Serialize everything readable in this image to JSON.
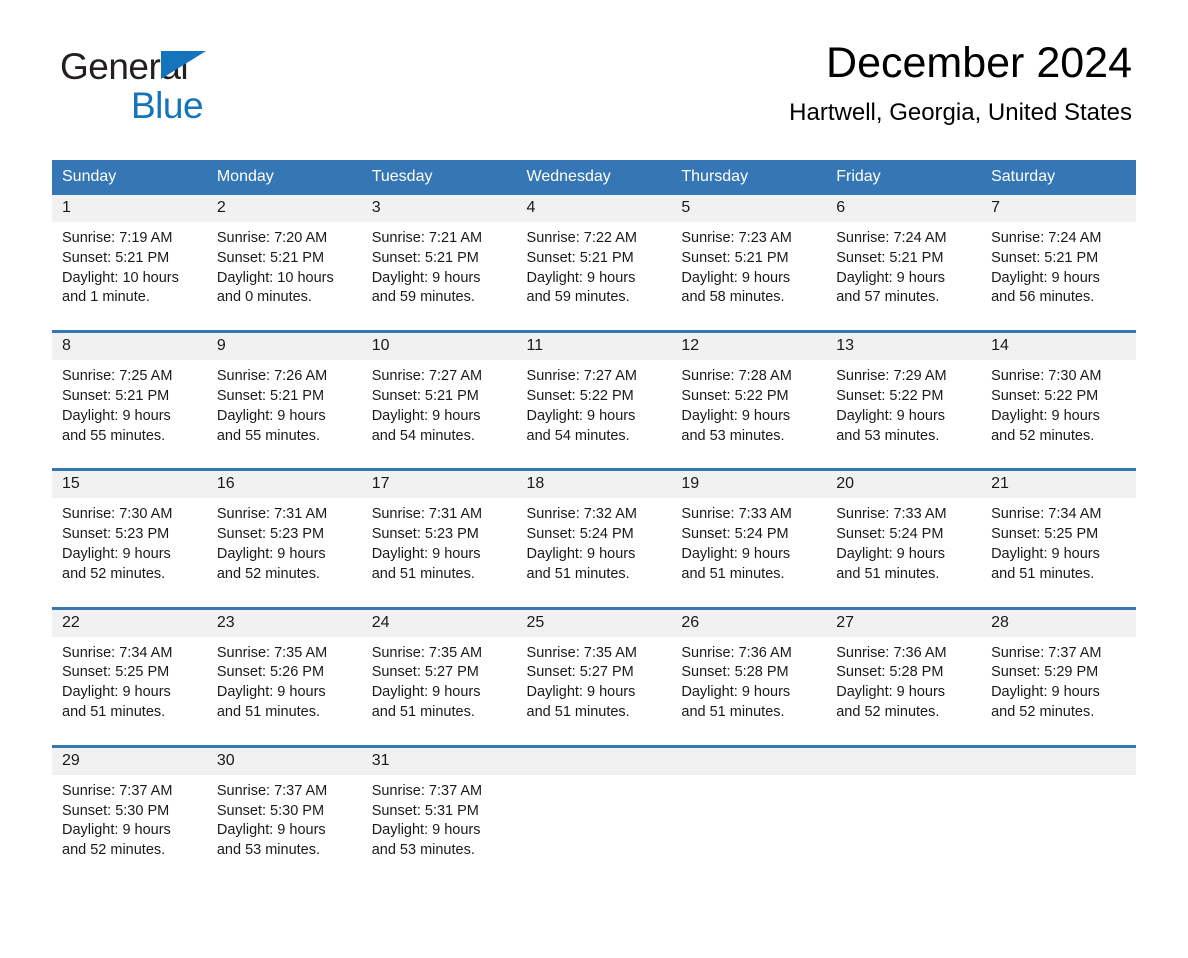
{
  "brand": {
    "name_line1": "General",
    "name_line2": "Blue",
    "accent_color": "#1474bc"
  },
  "header": {
    "title": "December 2024",
    "location": "Hartwell, Georgia, United States"
  },
  "calendar": {
    "header_bg": "#3576b5",
    "daynum_bg": "#f1f1f1",
    "weekday_headers": [
      "Sunday",
      "Monday",
      "Tuesday",
      "Wednesday",
      "Thursday",
      "Friday",
      "Saturday"
    ],
    "weeks": [
      [
        {
          "day": "1",
          "sunrise": "Sunrise: 7:19 AM",
          "sunset": "Sunset: 5:21 PM",
          "daylight_1": "Daylight: 10 hours",
          "daylight_2": "and 1 minute."
        },
        {
          "day": "2",
          "sunrise": "Sunrise: 7:20 AM",
          "sunset": "Sunset: 5:21 PM",
          "daylight_1": "Daylight: 10 hours",
          "daylight_2": "and 0 minutes."
        },
        {
          "day": "3",
          "sunrise": "Sunrise: 7:21 AM",
          "sunset": "Sunset: 5:21 PM",
          "daylight_1": "Daylight: 9 hours",
          "daylight_2": "and 59 minutes."
        },
        {
          "day": "4",
          "sunrise": "Sunrise: 7:22 AM",
          "sunset": "Sunset: 5:21 PM",
          "daylight_1": "Daylight: 9 hours",
          "daylight_2": "and 59 minutes."
        },
        {
          "day": "5",
          "sunrise": "Sunrise: 7:23 AM",
          "sunset": "Sunset: 5:21 PM",
          "daylight_1": "Daylight: 9 hours",
          "daylight_2": "and 58 minutes."
        },
        {
          "day": "6",
          "sunrise": "Sunrise: 7:24 AM",
          "sunset": "Sunset: 5:21 PM",
          "daylight_1": "Daylight: 9 hours",
          "daylight_2": "and 57 minutes."
        },
        {
          "day": "7",
          "sunrise": "Sunrise: 7:24 AM",
          "sunset": "Sunset: 5:21 PM",
          "daylight_1": "Daylight: 9 hours",
          "daylight_2": "and 56 minutes."
        }
      ],
      [
        {
          "day": "8",
          "sunrise": "Sunrise: 7:25 AM",
          "sunset": "Sunset: 5:21 PM",
          "daylight_1": "Daylight: 9 hours",
          "daylight_2": "and 55 minutes."
        },
        {
          "day": "9",
          "sunrise": "Sunrise: 7:26 AM",
          "sunset": "Sunset: 5:21 PM",
          "daylight_1": "Daylight: 9 hours",
          "daylight_2": "and 55 minutes."
        },
        {
          "day": "10",
          "sunrise": "Sunrise: 7:27 AM",
          "sunset": "Sunset: 5:21 PM",
          "daylight_1": "Daylight: 9 hours",
          "daylight_2": "and 54 minutes."
        },
        {
          "day": "11",
          "sunrise": "Sunrise: 7:27 AM",
          "sunset": "Sunset: 5:22 PM",
          "daylight_1": "Daylight: 9 hours",
          "daylight_2": "and 54 minutes."
        },
        {
          "day": "12",
          "sunrise": "Sunrise: 7:28 AM",
          "sunset": "Sunset: 5:22 PM",
          "daylight_1": "Daylight: 9 hours",
          "daylight_2": "and 53 minutes."
        },
        {
          "day": "13",
          "sunrise": "Sunrise: 7:29 AM",
          "sunset": "Sunset: 5:22 PM",
          "daylight_1": "Daylight: 9 hours",
          "daylight_2": "and 53 minutes."
        },
        {
          "day": "14",
          "sunrise": "Sunrise: 7:30 AM",
          "sunset": "Sunset: 5:22 PM",
          "daylight_1": "Daylight: 9 hours",
          "daylight_2": "and 52 minutes."
        }
      ],
      [
        {
          "day": "15",
          "sunrise": "Sunrise: 7:30 AM",
          "sunset": "Sunset: 5:23 PM",
          "daylight_1": "Daylight: 9 hours",
          "daylight_2": "and 52 minutes."
        },
        {
          "day": "16",
          "sunrise": "Sunrise: 7:31 AM",
          "sunset": "Sunset: 5:23 PM",
          "daylight_1": "Daylight: 9 hours",
          "daylight_2": "and 52 minutes."
        },
        {
          "day": "17",
          "sunrise": "Sunrise: 7:31 AM",
          "sunset": "Sunset: 5:23 PM",
          "daylight_1": "Daylight: 9 hours",
          "daylight_2": "and 51 minutes."
        },
        {
          "day": "18",
          "sunrise": "Sunrise: 7:32 AM",
          "sunset": "Sunset: 5:24 PM",
          "daylight_1": "Daylight: 9 hours",
          "daylight_2": "and 51 minutes."
        },
        {
          "day": "19",
          "sunrise": "Sunrise: 7:33 AM",
          "sunset": "Sunset: 5:24 PM",
          "daylight_1": "Daylight: 9 hours",
          "daylight_2": "and 51 minutes."
        },
        {
          "day": "20",
          "sunrise": "Sunrise: 7:33 AM",
          "sunset": "Sunset: 5:24 PM",
          "daylight_1": "Daylight: 9 hours",
          "daylight_2": "and 51 minutes."
        },
        {
          "day": "21",
          "sunrise": "Sunrise: 7:34 AM",
          "sunset": "Sunset: 5:25 PM",
          "daylight_1": "Daylight: 9 hours",
          "daylight_2": "and 51 minutes."
        }
      ],
      [
        {
          "day": "22",
          "sunrise": "Sunrise: 7:34 AM",
          "sunset": "Sunset: 5:25 PM",
          "daylight_1": "Daylight: 9 hours",
          "daylight_2": "and 51 minutes."
        },
        {
          "day": "23",
          "sunrise": "Sunrise: 7:35 AM",
          "sunset": "Sunset: 5:26 PM",
          "daylight_1": "Daylight: 9 hours",
          "daylight_2": "and 51 minutes."
        },
        {
          "day": "24",
          "sunrise": "Sunrise: 7:35 AM",
          "sunset": "Sunset: 5:27 PM",
          "daylight_1": "Daylight: 9 hours",
          "daylight_2": "and 51 minutes."
        },
        {
          "day": "25",
          "sunrise": "Sunrise: 7:35 AM",
          "sunset": "Sunset: 5:27 PM",
          "daylight_1": "Daylight: 9 hours",
          "daylight_2": "and 51 minutes."
        },
        {
          "day": "26",
          "sunrise": "Sunrise: 7:36 AM",
          "sunset": "Sunset: 5:28 PM",
          "daylight_1": "Daylight: 9 hours",
          "daylight_2": "and 51 minutes."
        },
        {
          "day": "27",
          "sunrise": "Sunrise: 7:36 AM",
          "sunset": "Sunset: 5:28 PM",
          "daylight_1": "Daylight: 9 hours",
          "daylight_2": "and 52 minutes."
        },
        {
          "day": "28",
          "sunrise": "Sunrise: 7:37 AM",
          "sunset": "Sunset: 5:29 PM",
          "daylight_1": "Daylight: 9 hours",
          "daylight_2": "and 52 minutes."
        }
      ],
      [
        {
          "day": "29",
          "sunrise": "Sunrise: 7:37 AM",
          "sunset": "Sunset: 5:30 PM",
          "daylight_1": "Daylight: 9 hours",
          "daylight_2": "and 52 minutes."
        },
        {
          "day": "30",
          "sunrise": "Sunrise: 7:37 AM",
          "sunset": "Sunset: 5:30 PM",
          "daylight_1": "Daylight: 9 hours",
          "daylight_2": "and 53 minutes."
        },
        {
          "day": "31",
          "sunrise": "Sunrise: 7:37 AM",
          "sunset": "Sunset: 5:31 PM",
          "daylight_1": "Daylight: 9 hours",
          "daylight_2": "and 53 minutes."
        },
        {
          "day": "",
          "sunrise": "",
          "sunset": "",
          "daylight_1": "",
          "daylight_2": ""
        },
        {
          "day": "",
          "sunrise": "",
          "sunset": "",
          "daylight_1": "",
          "daylight_2": ""
        },
        {
          "day": "",
          "sunrise": "",
          "sunset": "",
          "daylight_1": "",
          "daylight_2": ""
        },
        {
          "day": "",
          "sunrise": "",
          "sunset": "",
          "daylight_1": "",
          "daylight_2": ""
        }
      ]
    ]
  }
}
